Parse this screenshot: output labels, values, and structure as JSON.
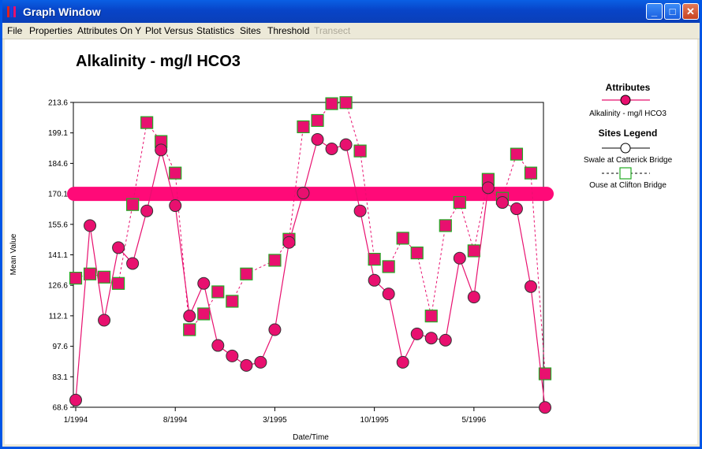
{
  "window": {
    "title": "Graph Window"
  },
  "menu": [
    "File",
    "Properties",
    "Attributes On Y",
    "Plot Versus",
    "Statistics",
    "Sites",
    "Threshold",
    "Transect"
  ],
  "colors": {
    "series1": "#e8106f",
    "series2_border": "#22aa22",
    "threshold": "#ff0a78"
  },
  "chart_data": {
    "type": "line",
    "title": "Alkalinity - mg/l HCO3",
    "xlabel": "Date/Time",
    "ylabel": "Mean Value",
    "ylim": [
      68.6,
      213.6
    ],
    "yticks": [
      "213.6",
      "199.1",
      "184.6",
      "170.1",
      "155.6",
      "141.1",
      "126.6",
      "112.1",
      "97.6",
      "83.1",
      "68.6"
    ],
    "xticks": [
      "1/1994",
      "8/1994",
      "3/1995",
      "10/1995",
      "5/1996"
    ],
    "threshold": 170.1,
    "legend": {
      "attributes_title": "Attributes",
      "attribute_label": "Alkalinity - mg/l HCO3",
      "sites_title": "Sites Legend",
      "site1_label": "Swale at Catterick Bridge",
      "site2_label": "Ouse at Clifton Bridge"
    },
    "series": [
      {
        "name": "Swale at Catterick Bridge",
        "x": [
          0,
          1,
          2,
          3,
          4,
          5,
          6,
          7,
          8,
          9,
          10,
          11,
          12,
          13,
          14,
          15,
          16,
          17,
          18,
          19,
          20,
          21,
          22,
          23,
          24,
          25,
          26,
          27,
          28,
          29,
          30,
          31,
          32,
          33
        ],
        "values": [
          72,
          155,
          110,
          144.5,
          137,
          162,
          191,
          164.5,
          112,
          127.5,
          98,
          93,
          88.5,
          90,
          105.5,
          147,
          170.5,
          196,
          191.5,
          193.5,
          162,
          129,
          122.5,
          90,
          103.5,
          101.5,
          100.5,
          139.5,
          121,
          173,
          166,
          163,
          126,
          68.5
        ]
      },
      {
        "name": "Ouse at Clifton Bridge",
        "x": [
          0,
          1,
          2,
          3,
          4,
          5,
          6,
          7,
          8,
          9,
          10,
          11,
          12,
          13,
          14,
          15,
          16,
          17,
          18,
          19,
          20,
          21,
          22,
          23,
          24,
          25,
          26,
          27,
          28,
          29,
          30,
          31,
          32,
          33
        ],
        "values": [
          130,
          132,
          130.5,
          127.5,
          165,
          204,
          195,
          180,
          105.5,
          113,
          123.5,
          119,
          132,
          null,
          138.5,
          148.5,
          202,
          205,
          213,
          213.5,
          190.5,
          139,
          135.5,
          149,
          142,
          112,
          155,
          166,
          143,
          177,
          168,
          189,
          180,
          84.5
        ]
      }
    ]
  }
}
